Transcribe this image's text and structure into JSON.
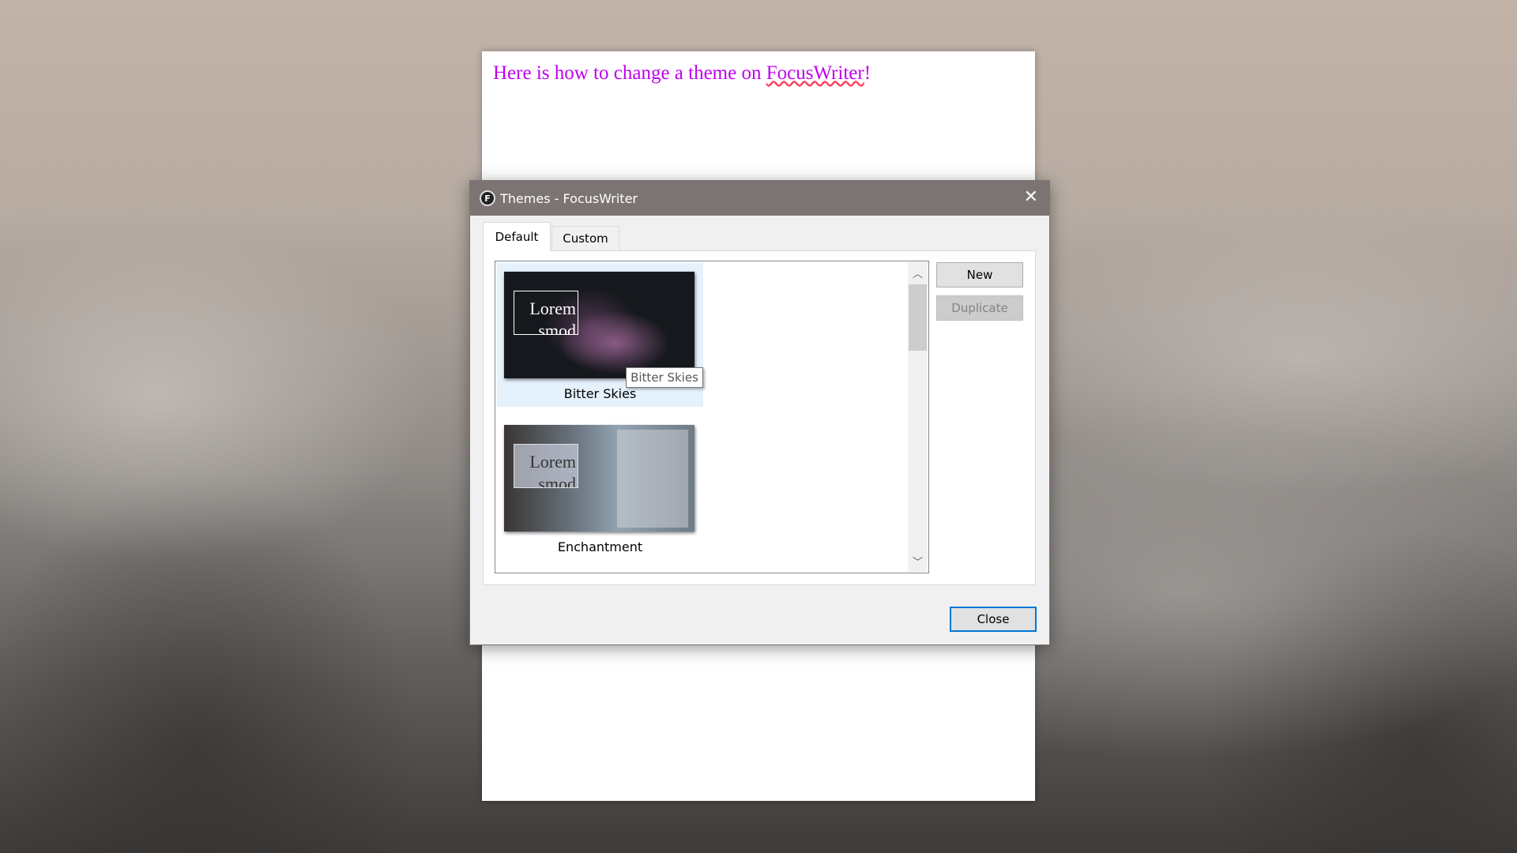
{
  "document": {
    "text_before": "Here is how to change a theme on ",
    "text_link": "FocusWriter",
    "text_after": "!"
  },
  "dialog": {
    "title": "Themes - FocusWriter",
    "app_icon_letter": "F",
    "tabs": [
      {
        "label": "Default",
        "active": true
      },
      {
        "label": "Custom",
        "active": false
      }
    ],
    "themes": [
      {
        "name": "Bitter Skies",
        "preview_text": "Lorem smod orr",
        "selected": true
      },
      {
        "name": "Enchantment",
        "preview_text": "Lorem smod orr",
        "selected": false
      }
    ],
    "buttons": {
      "new": "New",
      "duplicate": "Duplicate",
      "close": "Close"
    },
    "tooltip": "Bitter Skies"
  }
}
